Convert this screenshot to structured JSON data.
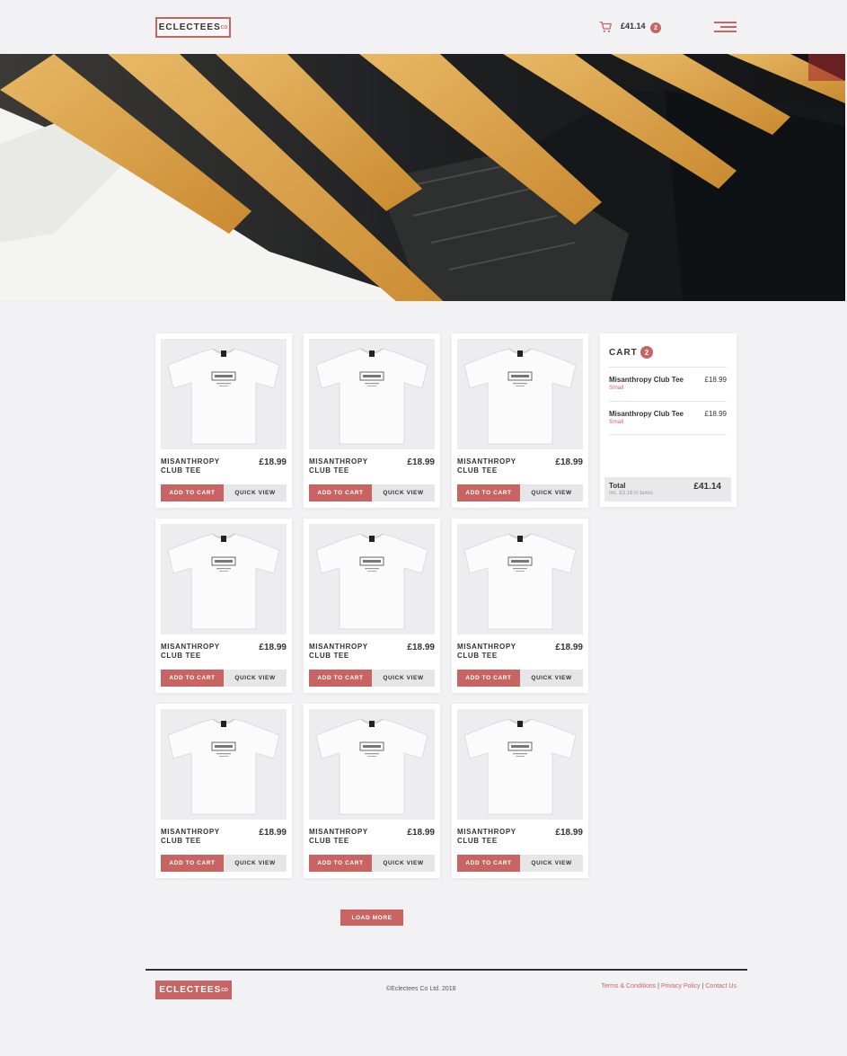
{
  "header": {
    "logo_text": "ECLECTEES",
    "logo_suffix": "CO",
    "cart_total": "£41.14",
    "cart_count": "2",
    "cart_icon": "cart-icon",
    "menu_icon": "hamburger-menu-icon"
  },
  "products": [
    {
      "name": "MISANTHROPY CLUB TEE",
      "price": "£18.99",
      "add_label": "ADD TO CART",
      "quick_label": "QUICK VIEW"
    },
    {
      "name": "MISANTHROPY CLUB TEE",
      "price": "£18.99",
      "add_label": "ADD TO CART",
      "quick_label": "QUICK VIEW"
    },
    {
      "name": "MISANTHROPY CLUB TEE",
      "price": "£18.99",
      "add_label": "ADD TO CART",
      "quick_label": "QUICK VIEW"
    },
    {
      "name": "MISANTHROPY CLUB TEE",
      "price": "£18.99",
      "add_label": "ADD TO CART",
      "quick_label": "QUICK VIEW"
    },
    {
      "name": "MISANTHROPY CLUB TEE",
      "price": "£18.99",
      "add_label": "ADD TO CART",
      "quick_label": "QUICK VIEW"
    },
    {
      "name": "MISANTHROPY CLUB TEE",
      "price": "£18.99",
      "add_label": "ADD TO CART",
      "quick_label": "QUICK VIEW"
    },
    {
      "name": "MISANTHROPY CLUB TEE",
      "price": "£18.99",
      "add_label": "ADD TO CART",
      "quick_label": "QUICK VIEW"
    },
    {
      "name": "MISANTHROPY CLUB TEE",
      "price": "£18.99",
      "add_label": "ADD TO CART",
      "quick_label": "QUICK VIEW"
    },
    {
      "name": "MISANTHROPY CLUB TEE",
      "price": "£18.99",
      "add_label": "ADD TO CART",
      "quick_label": "QUICK VIEW"
    }
  ],
  "cart": {
    "title": "CART",
    "count": "2",
    "items": [
      {
        "name": "Misanthropy Club Tee",
        "size": "Small",
        "price": "£18.99"
      },
      {
        "name": "Misanthropy Club Tee",
        "size": "Small",
        "price": "£18.99"
      }
    ],
    "total_label": "Total",
    "tax_note": "Inc. £3.16 in taxes",
    "total_value": "£41.14"
  },
  "load_more_label": "LOAD MORE",
  "footer": {
    "logo_text": "ECLECTEES",
    "logo_suffix": "CO",
    "copyright": "©Eclectees Co Ltd. 2018",
    "links": [
      "Terms & Conditions",
      "Privacy Policy",
      "Contact Us"
    ],
    "separator": "|"
  },
  "colors": {
    "accent": "#c86563",
    "background": "#f2f1f4",
    "text": "#2b2b2b"
  }
}
